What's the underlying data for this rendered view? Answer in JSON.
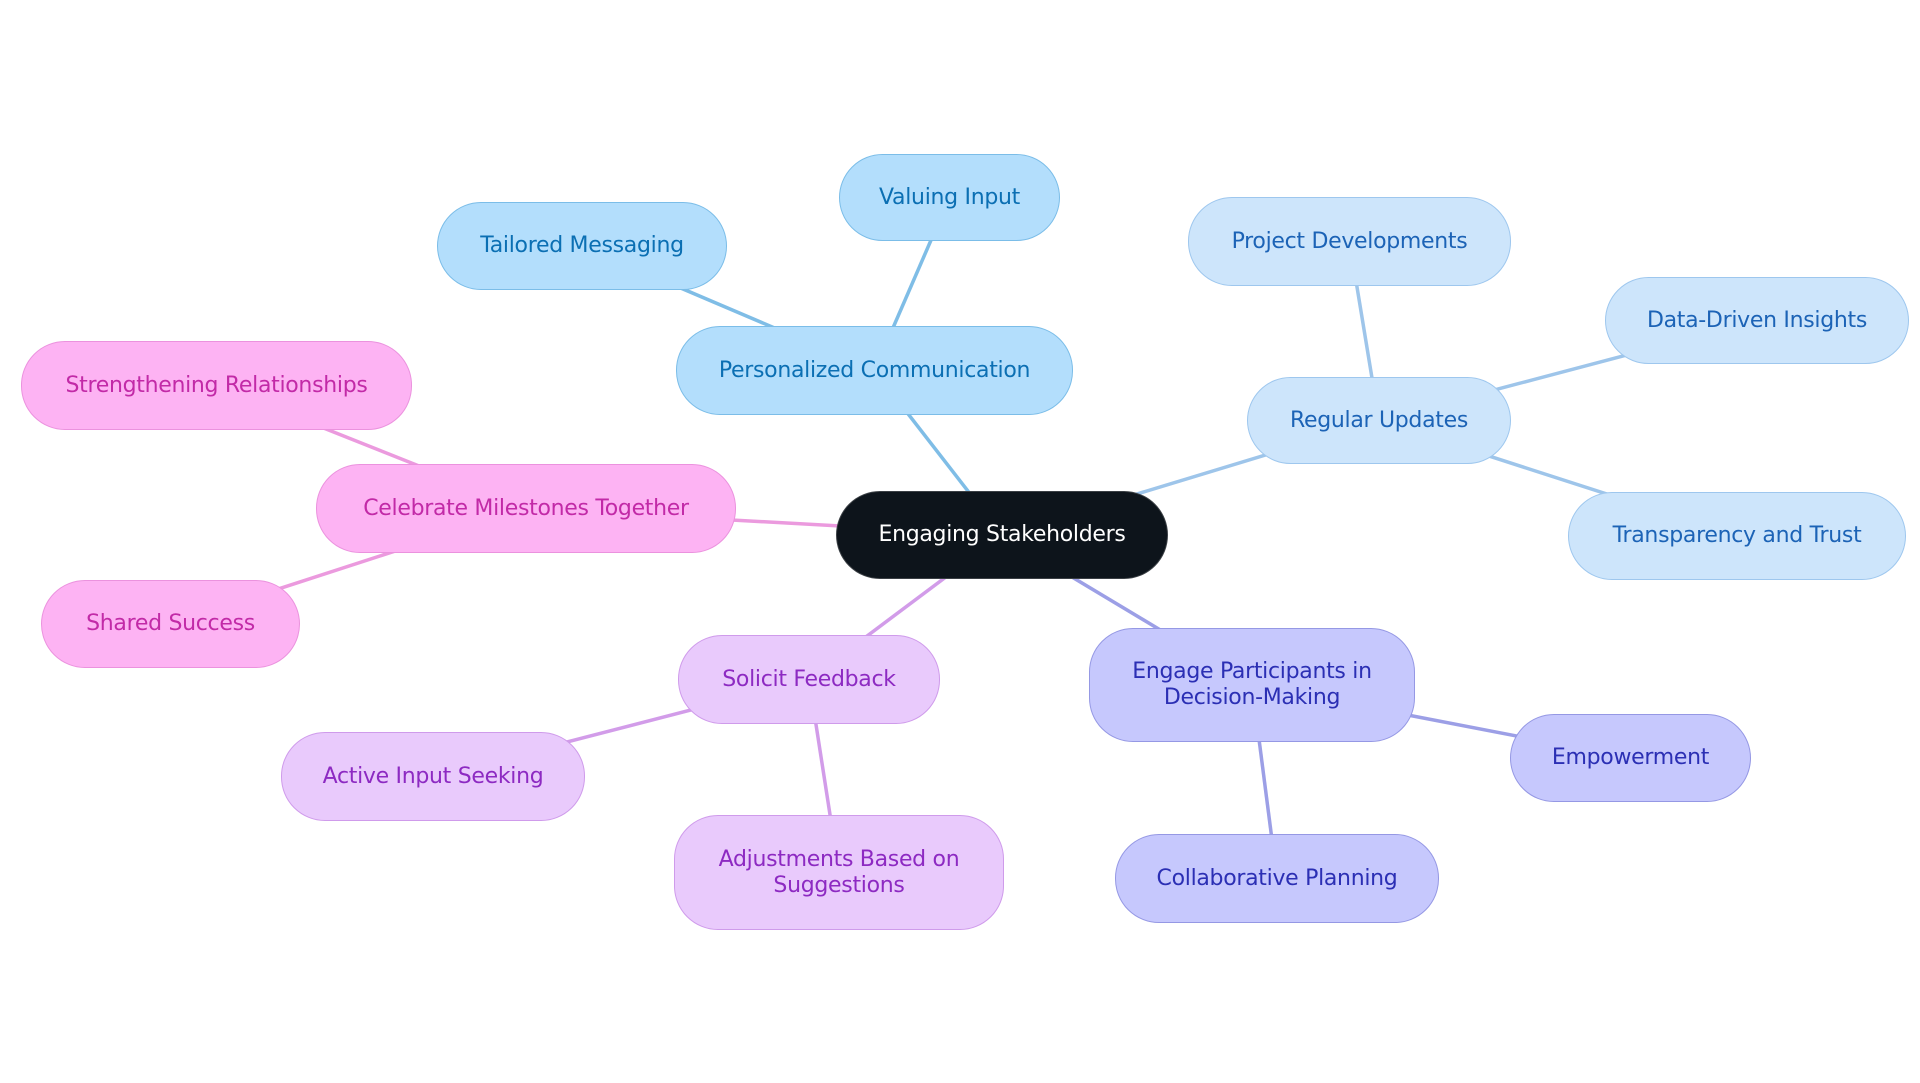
{
  "diagram": {
    "type": "mind-map",
    "root": {
      "id": "root",
      "label": "Engaging Stakeholders"
    },
    "branches": [
      {
        "id": "pc",
        "label": "Personalized Communication",
        "style": "b1",
        "edge_color": "#7fbde6",
        "children": [
          {
            "id": "tm",
            "label": "Tailored Messaging"
          },
          {
            "id": "vi",
            "label": "Valuing Input"
          }
        ]
      },
      {
        "id": "ru",
        "label": "Regular Updates",
        "style": "b2",
        "edge_color": "#9ec5ea",
        "children": [
          {
            "id": "pd",
            "label": "Project Developments"
          },
          {
            "id": "dd",
            "label": "Data-Driven Insights"
          },
          {
            "id": "tt",
            "label": "Transparency and Trust"
          }
        ]
      },
      {
        "id": "ep",
        "label": "Engage Participants in Decision-Making",
        "style": "b3",
        "edge_color": "#9c9fe6",
        "children": [
          {
            "id": "em",
            "label": "Empowerment"
          },
          {
            "id": "cp",
            "label": "Collaborative Planning"
          }
        ]
      },
      {
        "id": "sf",
        "label": "Solicit Feedback",
        "style": "b4",
        "edge_color": "#d29ce9",
        "children": [
          {
            "id": "ai",
            "label": "Active Input Seeking"
          },
          {
            "id": "ad",
            "label": "Adjustments Based on Suggestions"
          }
        ]
      },
      {
        "id": "cm",
        "label": "Celebrate Milestones Together",
        "style": "b5",
        "edge_color": "#eb9ade",
        "children": [
          {
            "id": "sr",
            "label": "Strengthening Relationships"
          },
          {
            "id": "ss",
            "label": "Shared Success"
          }
        ]
      }
    ]
  }
}
